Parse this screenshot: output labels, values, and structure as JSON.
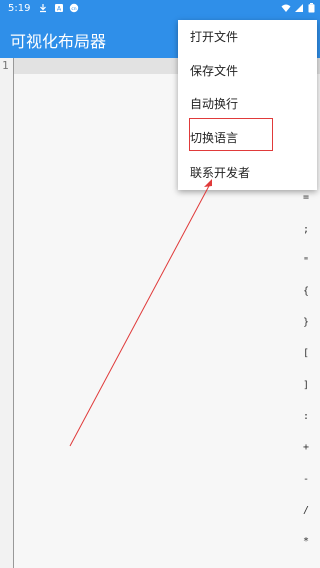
{
  "status_bar": {
    "time": "5:19",
    "icons": [
      "download-icon",
      "a-box-icon",
      "notification-icon",
      "wifi-icon",
      "signal-icon",
      "battery-icon"
    ]
  },
  "app_bar": {
    "title": "可视化布局器",
    "menu_icon": "more-vert-icon"
  },
  "editor": {
    "line_number": "1",
    "symbol_bar": [
      "=",
      ";",
      "\"",
      "{",
      "}",
      "[",
      "]",
      ":",
      "+",
      "-",
      "/",
      "*"
    ]
  },
  "menu": {
    "items": [
      {
        "label": "打开文件"
      },
      {
        "label": "保存文件"
      },
      {
        "label": "自动换行"
      },
      {
        "label": "切换语言"
      },
      {
        "label": "联系开发者"
      }
    ],
    "highlighted_index": 3
  },
  "annotation": {
    "color": "#e03a3a"
  },
  "colors": {
    "primary": "#2f8fe9",
    "editor_bg": "#f7f7f7"
  }
}
